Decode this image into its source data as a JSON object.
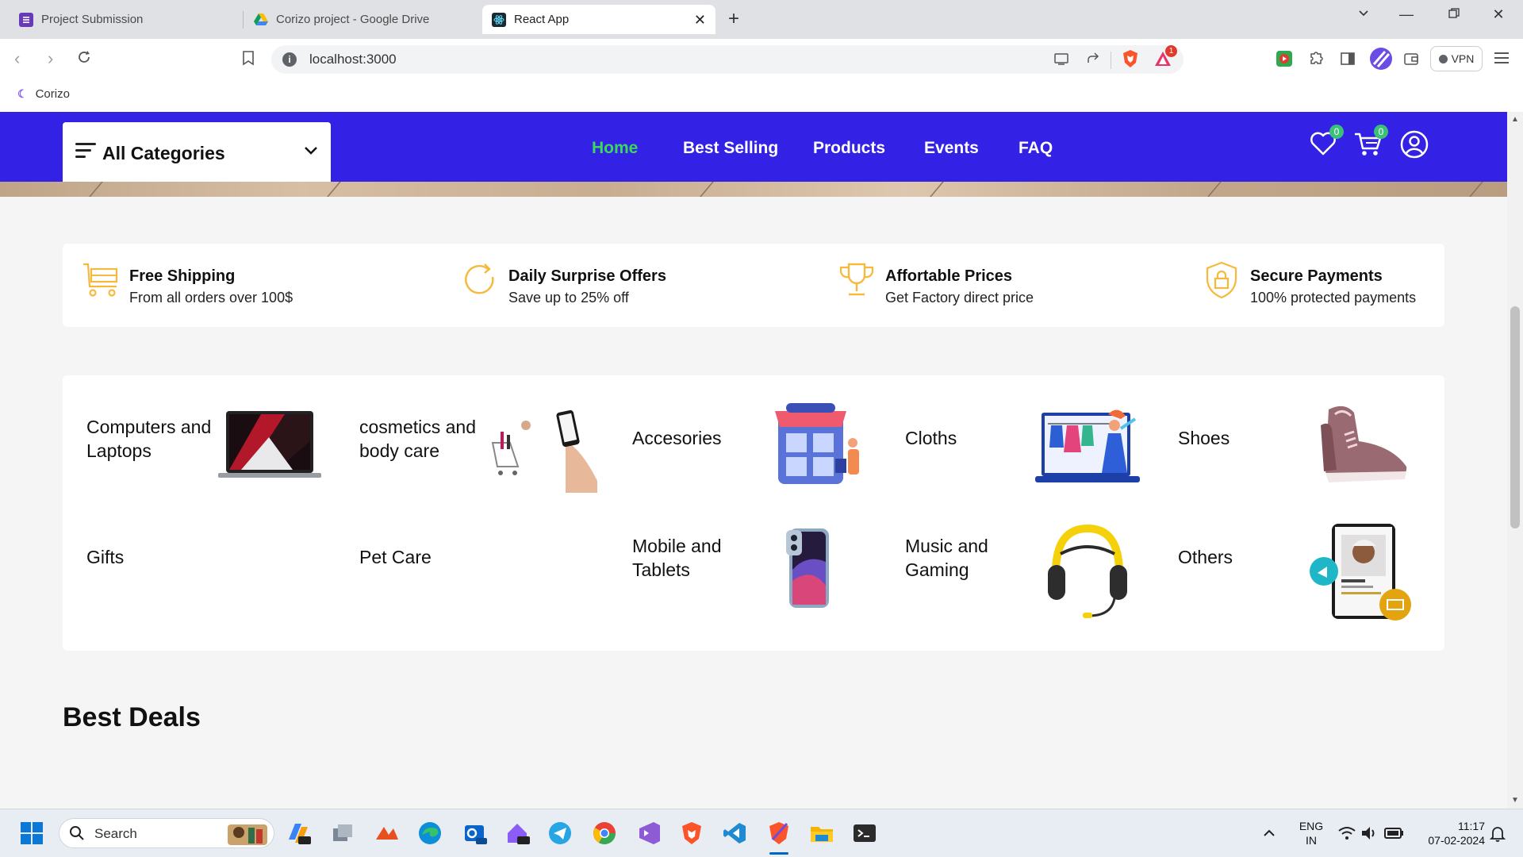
{
  "browser": {
    "tabs": [
      {
        "title": "Project Submission",
        "icon": "forms-icon",
        "color": "#673ab7"
      },
      {
        "title": "Corizo project - Google Drive",
        "icon": "drive-icon"
      },
      {
        "title": "React App",
        "icon": "react-icon",
        "active": true
      }
    ],
    "url": "localhost:3000",
    "vpn_label": "VPN",
    "bookmark": "Corizo",
    "notification_count": "1"
  },
  "site": {
    "all_categories": "All Categories",
    "menu": [
      {
        "label": "Home",
        "active": true
      },
      {
        "label": "Best Selling"
      },
      {
        "label": "Products"
      },
      {
        "label": "Events"
      },
      {
        "label": "FAQ"
      }
    ],
    "wishlist_count": "0",
    "cart_count": "0",
    "colors": {
      "nav": "#3321e6",
      "active_menu": "#3cd85a",
      "feature_icon": "#f6b93b",
      "badge": "#3bc177"
    },
    "features": [
      {
        "title": "Free Shipping",
        "subtitle": "From all orders over 100$",
        "icon": "cart-icon"
      },
      {
        "title": "Daily Surprise Offers",
        "subtitle": "Save up to 25% off",
        "icon": "refresh-icon"
      },
      {
        "title": "Affortable Prices",
        "subtitle": "Get Factory direct price",
        "icon": "trophy-icon"
      },
      {
        "title": "Secure Payments",
        "subtitle": "100% protected payments",
        "icon": "shield-lock-icon"
      }
    ],
    "categories": [
      {
        "label": "Computers and Laptops",
        "icon": "laptop-image"
      },
      {
        "label": "cosmetics and body care",
        "icon": "cosmetics-image"
      },
      {
        "label": "Accesories",
        "icon": "shop-image"
      },
      {
        "label": "Cloths",
        "icon": "clothes-image"
      },
      {
        "label": "Shoes",
        "icon": "shoe-image"
      },
      {
        "label": "Gifts",
        "icon": ""
      },
      {
        "label": "Pet Care",
        "icon": ""
      },
      {
        "label": "Mobile and Tablets",
        "icon": "phone-image"
      },
      {
        "label": "Music and Gaming",
        "icon": "headphones-image"
      },
      {
        "label": "Others",
        "icon": "app-promo-image"
      }
    ],
    "best_deals_heading": "Best Deals"
  },
  "taskbar": {
    "search_placeholder": "Search",
    "language": "ENG",
    "region": "IN",
    "time": "11:17",
    "date": "07-02-2024"
  }
}
